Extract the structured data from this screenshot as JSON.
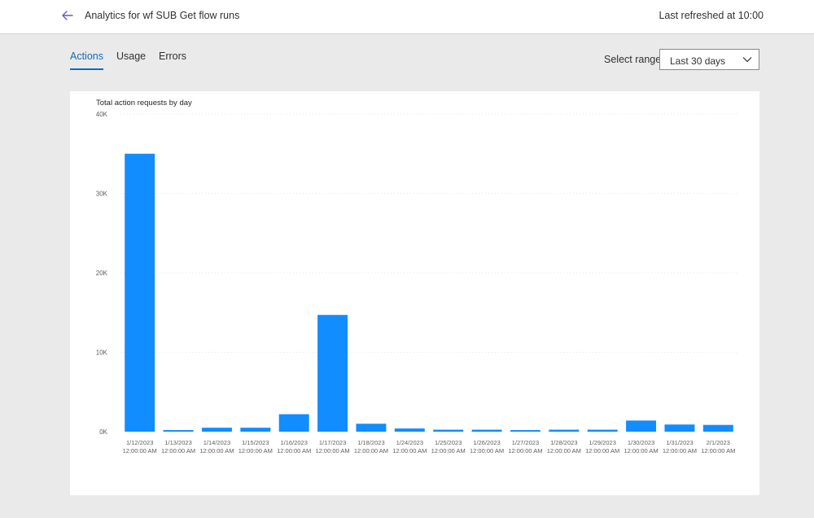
{
  "header": {
    "title": "Analytics for wf SUB Get flow runs",
    "refresh": "Last refreshed at 10:00"
  },
  "tabs": [
    {
      "label": "Actions",
      "active": true
    },
    {
      "label": "Usage",
      "active": false
    },
    {
      "label": "Errors",
      "active": false
    }
  ],
  "range": {
    "label": "Select range",
    "value": "Last 30 days"
  },
  "icons": {
    "back": "arrow-left-icon",
    "dropdown": "chevron-down-icon"
  },
  "colors": {
    "accent": "#0f6cbd",
    "bar": "#118dff",
    "gridline": "#e6e6e6"
  },
  "chart_data": {
    "type": "bar",
    "title": "Total action requests by day",
    "xlabel": "",
    "ylabel": "",
    "ylim": [
      0,
      40000
    ],
    "yticks": [
      {
        "value": 0,
        "label": "0K"
      },
      {
        "value": 10000,
        "label": "10K"
      },
      {
        "value": 20000,
        "label": "20K"
      },
      {
        "value": 30000,
        "label": "30K"
      },
      {
        "value": 40000,
        "label": "40K"
      }
    ],
    "grid": true,
    "categories": [
      [
        "1/12/2023",
        "12:00:00 AM"
      ],
      [
        "1/13/2023",
        "12:00:00 AM"
      ],
      [
        "1/14/2023",
        "12:00:00 AM"
      ],
      [
        "1/15/2023",
        "12:00:00 AM"
      ],
      [
        "1/16/2023",
        "12:00:00 AM"
      ],
      [
        "1/17/2023",
        "12:00:00 AM"
      ],
      [
        "1/18/2023",
        "12:00:00 AM"
      ],
      [
        "1/24/2023",
        "12:00:00 AM"
      ],
      [
        "1/25/2023",
        "12:00:00 AM"
      ],
      [
        "1/26/2023",
        "12:00:00 AM"
      ],
      [
        "1/27/2023",
        "12:00:00 AM"
      ],
      [
        "1/28/2023",
        "12:00:00 AM"
      ],
      [
        "1/29/2023",
        "12:00:00 AM"
      ],
      [
        "1/30/2023",
        "12:00:00 AM"
      ],
      [
        "1/31/2023",
        "12:00:00 AM"
      ],
      [
        "2/1/2023",
        "12:00:00 AM"
      ]
    ],
    "values": [
      35000,
      200,
      500,
      500,
      2200,
      14700,
      1000,
      400,
      250,
      250,
      200,
      250,
      250,
      1400,
      900,
      850
    ]
  }
}
